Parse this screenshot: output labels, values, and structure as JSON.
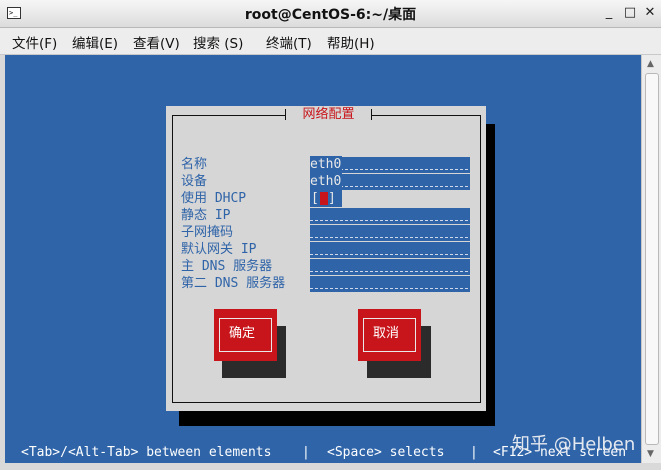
{
  "window": {
    "title": "root@CentOS-6:~/桌面",
    "icon": "terminal-icon",
    "controls": {
      "minimize": "_",
      "maximize": "□",
      "close": "✕"
    }
  },
  "menubar": {
    "items": [
      "文件(F)",
      "编辑(E)",
      "查看(V)",
      "搜索 (S)",
      "终端(T)",
      "帮助(H)"
    ]
  },
  "dialog": {
    "title": "网络配置",
    "labels": {
      "name": "名称",
      "device": "设备",
      "use_dhcp": "使用 DHCP",
      "static_ip": "静态 IP",
      "netmask": "子网掩码",
      "gateway": "默认网关 IP",
      "primary_dns": "主 DNS 服务器",
      "secondary_dns": "第二 DNS 服务器"
    },
    "values": {
      "name": "eth0",
      "device": "eth0",
      "use_dhcp_checked": false,
      "static_ip": "",
      "netmask": "",
      "gateway": "",
      "primary_dns": "",
      "secondary_dns": ""
    },
    "checkbox": {
      "left": "[",
      "right": "]"
    },
    "buttons": {
      "ok": "确定",
      "cancel": "取消"
    }
  },
  "statusbar": {
    "tab_hint": "<Tab>/<Alt-Tab> between elements",
    "sep": "|",
    "space_hint": "<Space> selects",
    "f12_hint": "<F12> next screen"
  },
  "watermark": "知乎 @Helben",
  "colors": {
    "terminal_bg": "#2f64a8",
    "dialog_bg": "#d6d6d6",
    "accent_red": "#c8151b"
  }
}
